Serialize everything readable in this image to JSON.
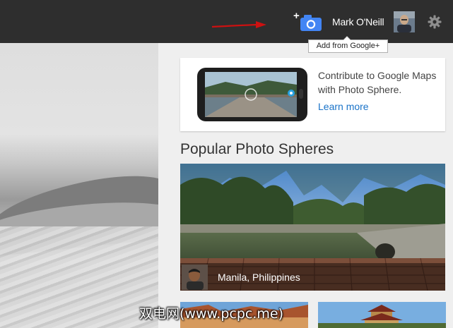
{
  "header": {
    "user_name": "Mark O'Neill",
    "add_tooltip": "Add from Google+"
  },
  "icons": {
    "add_photo": "add-photo-camera-icon",
    "settings": "gear-icon",
    "annotation": "red-arrow-annotation"
  },
  "promo": {
    "text": "Contribute to Google Maps with Photo Sphere.",
    "link": "Learn more"
  },
  "popular": {
    "title": "Popular Photo Spheres",
    "featured_location": "Manila, Philippines"
  },
  "watermark": "双电网(www.pcpc.me)",
  "colors": {
    "topbar": "#2e2e2e",
    "camera_blue": "#4285f4",
    "arrow_red": "#cc1111",
    "link_blue": "#1a73c8"
  }
}
